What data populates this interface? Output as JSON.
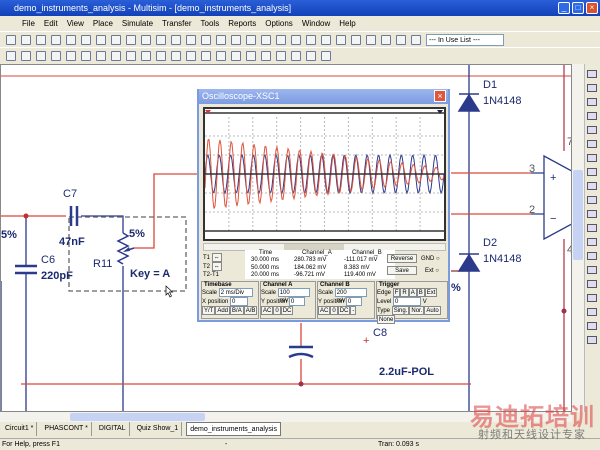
{
  "window": {
    "title": "demo_instruments_analysis - Multisim - [demo_instruments_analysis]"
  },
  "menu": [
    "File",
    "Edit",
    "View",
    "Place",
    "Simulate",
    "Transfer",
    "Tools",
    "Reports",
    "Options",
    "Window",
    "Help"
  ],
  "toolbar": {
    "in_use_list": "--- In Use List ---"
  },
  "schematic": {
    "c7": "C7",
    "c7_val": "47nF",
    "c6": "C6",
    "c6_val": "220pF",
    "r11": "R11",
    "r11_pct": "5%",
    "r11_key": "Key = A",
    "left_pct": "5%",
    "d1": "D1",
    "d1_val": "1N4148",
    "d2": "D2",
    "d2_val": "1N4148",
    "c8": "C8",
    "c8_val": "2.2uF-POL",
    "pin3": "3",
    "pin2": "2",
    "pin7": "7",
    "pin4": "4",
    "plus": "+",
    "minus": "−",
    "pct_mid": "%"
  },
  "oscilloscope": {
    "title": "Oscilloscope-XSC1",
    "headers": [
      "Time",
      "Channel_A",
      "Channel_B"
    ],
    "rows": [
      {
        "label": "T1",
        "time": "30.000 ms",
        "a": "280.783 mV",
        "b": "-111.017 mV"
      },
      {
        "label": "T2",
        "time": "50.000 ms",
        "a": "184.062 mV",
        "b": "8.383 mV"
      },
      {
        "label": "T2-T1",
        "time": "20.000 ms",
        "a": "-96.721 mV",
        "b": "119.400 mV"
      }
    ],
    "reverse": "Reverse",
    "save": "Save",
    "gnd": "GND",
    "ext": "Ext",
    "timebase": {
      "label": "Timebase",
      "scale_label": "Scale",
      "scale": "2 ms/Div",
      "xpos_label": "X position",
      "xpos": "0",
      "modes": [
        "Y/T",
        "Add",
        "B/A",
        "A/B"
      ]
    },
    "channel_a": {
      "label": "Channel A",
      "scale_label": "Scale",
      "scale": "100 mV/Div",
      "ypos_label": "Y position",
      "ypos": "0",
      "coupling": [
        "AC",
        "0",
        "DC"
      ]
    },
    "channel_b": {
      "label": "Channel B",
      "scale_label": "Scale",
      "scale": "200 mV/Div",
      "ypos_label": "Y position",
      "ypos": "0",
      "coupling": [
        "AC",
        "0",
        "DC",
        "-"
      ]
    },
    "trigger": {
      "label": "Trigger",
      "edge_label": "Edge",
      "edges": [
        "F",
        "R",
        "A",
        "B",
        "Ext"
      ],
      "level_label": "Level",
      "level": "0",
      "level_unit": "V",
      "type_label": "Type",
      "types": [
        "Sing.",
        "Nor.",
        "Auto",
        "None"
      ]
    },
    "waveform": {
      "cycles": 21,
      "a_amp_start_div": 1.9,
      "a_amp_end_div": 0.3,
      "b_amp_div": 1.0,
      "color_a": "#e0533b",
      "color_b": "#2c3a8c"
    }
  },
  "tabs": [
    "Circuit1 *",
    "PHASCONT *",
    "DIGITAL",
    "Quiz Show_1",
    "demo_instruments_analysis"
  ],
  "status": {
    "help": "For Help, press F1",
    "mid": "-",
    "tran": "Tran: 0.093 s"
  },
  "watermark": {
    "line1": "易迪拓培训",
    "line2": "射频和天线设计专家"
  }
}
